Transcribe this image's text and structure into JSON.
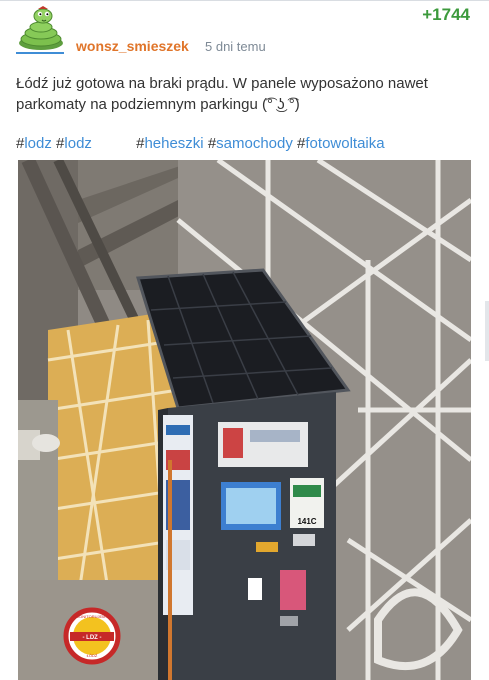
{
  "post": {
    "username": "wonsz_smieszek",
    "timestamp": "5 dni temu",
    "votes": "+1744",
    "body": "Łódź już gotowa na braki prądu. W panele wyposażono nawet parkomaty na podziemnym parkingu (͡° ͜ʖ ͡°)",
    "tags": [
      {
        "hash": "#",
        "label": "lodz"
      },
      {
        "hash": "#",
        "label": "lodz"
      },
      {
        "hash": "#",
        "label": "heheszki"
      },
      {
        "hash": "#",
        "label": "samochody"
      },
      {
        "hash": "#",
        "label": "fotowoltaika"
      }
    ],
    "photo_text": {
      "machine_price": "141C",
      "badge_top": "MONITORUJEMY",
      "badge_center": "- LDZ -",
      "badge_bottom": "ŁÓDŹ"
    }
  },
  "icons": {
    "avatar": "snake-avatar-icon"
  },
  "colors": {
    "username": "#e0752a",
    "votes": "#3c9a3c",
    "tag_link": "#3f8dd6",
    "timestamp": "#7e8a96"
  }
}
